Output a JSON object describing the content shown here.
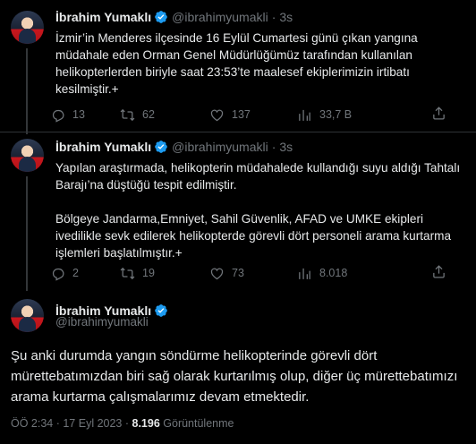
{
  "author": {
    "name": "İbrahim Yumaklı",
    "handle": "@ibrahimyumakli"
  },
  "tweets": [
    {
      "time": "3s",
      "text": "İzmir’in Menderes ilçesinde 16 Eylül Cumartesi günü çıkan yangına müdahale eden Orman Genel Müdürlüğümüz tarafından kullanılan helikopterlerden biriyle saat 23:53’te maalesef ekiplerimizin irtibatı kesilmiştir.+",
      "replies": "13",
      "retweets": "62",
      "likes": "137",
      "views": "33,7 B"
    },
    {
      "time": "3s",
      "text": "Yapılan araştırmada, helikopterin müdahalede kullandığı suyu aldığı Tahtalı Barajı’na düştüğü tespit edilmiştir.\n\nBölgeye Jandarma,Emniyet, Sahil Güvenlik, AFAD ve UMKE ekipleri ivedilikle sevk edilerek helikopterde görevli dört personeli arama kurtarma işlemleri başlatılmıştır.+",
      "replies": "2",
      "retweets": "19",
      "likes": "73",
      "views": "8.018"
    }
  ],
  "main_tweet": {
    "text": "Şu anki durumda yangın söndürme helikopterinde görevli dört mürettebatımızdan biri sağ olarak kurtarılmış olup, diğer üç mürettebatımızı arama kurtarma çalışmalarımız devam etmektedir.",
    "timestamp": "ÖÖ 2:34 · 17 Eyl 2023 ·",
    "views_count": "8.196",
    "views_label": "Görüntülenme"
  },
  "colors": {
    "background": "#000000",
    "text": "#e7e9ea",
    "secondary": "#71767b",
    "verified": "#1d9bf0",
    "divider": "#2f3336"
  },
  "icons": [
    "reply-icon",
    "retweet-icon",
    "like-icon",
    "views-icon",
    "share-icon",
    "verified-badge-icon"
  ]
}
